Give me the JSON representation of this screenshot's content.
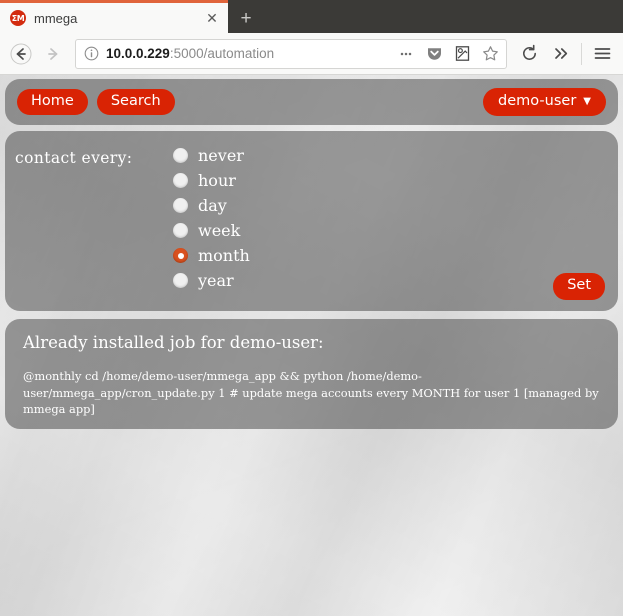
{
  "browser": {
    "tab": {
      "favicon_text": "ΣM",
      "favicon_name": "mmega-favicon",
      "title": "mmega",
      "close_label": "✕"
    },
    "new_tab_label": "+",
    "nav": {
      "back_label": "←",
      "forward_label": "→"
    },
    "url": {
      "host": "10.0.0.229",
      "path": ":5000/automation"
    },
    "urlbar_icons": [
      {
        "name": "page-actions-icon",
        "glyph": "⋯"
      },
      {
        "name": "pocket-icon",
        "glyph": "▼"
      },
      {
        "name": "reader-view-icon",
        "glyph": "▤"
      },
      {
        "name": "bookmark-star-icon",
        "glyph": "☆"
      }
    ],
    "toolbar_icons": [
      {
        "name": "reload-icon",
        "glyph": "⟳"
      },
      {
        "name": "overflow-chevrons-icon",
        "glyph": "»"
      },
      {
        "name": "hamburger-menu-icon",
        "glyph": "☰"
      }
    ]
  },
  "header": {
    "home_label": "Home",
    "search_label": "Search",
    "user_label": "demo-user",
    "user_caret": "▼"
  },
  "form": {
    "label": "contact every:",
    "options": [
      {
        "value": "never",
        "label": "never",
        "checked": false
      },
      {
        "value": "hour",
        "label": "hour",
        "checked": false
      },
      {
        "value": "day",
        "label": "day",
        "checked": false
      },
      {
        "value": "week",
        "label": "week",
        "checked": false
      },
      {
        "value": "month",
        "label": "month",
        "checked": true
      },
      {
        "value": "year",
        "label": "year",
        "checked": false
      }
    ],
    "submit_label": "Set"
  },
  "info": {
    "title": "Already installed job for demo-user:",
    "cron": "@monthly cd /home/demo-user/mmega_app && python /home/demo-user/mmega_app/cron_update.py 1 # update mega accounts every MONTH for user 1 [managed by mmega app]"
  },
  "colors": {
    "accent_red": "#d92304",
    "radio_selected": "#d9511f",
    "panel": "rgba(70,70,70,0.52)",
    "chrome_dark": "#3b3a37"
  }
}
